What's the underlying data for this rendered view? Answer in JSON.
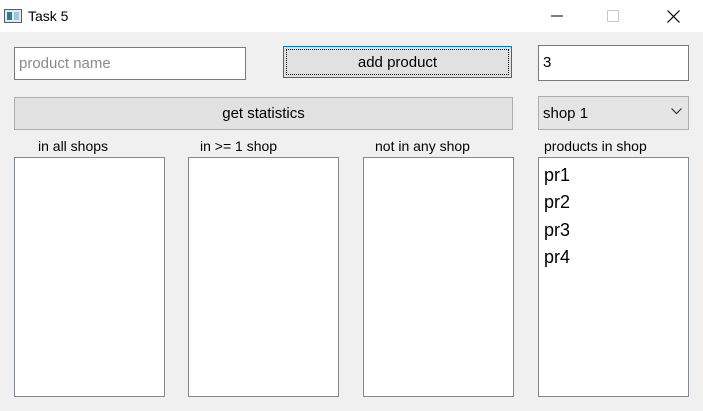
{
  "window": {
    "title": "Task 5",
    "icon": "app-window-icon",
    "controls": [
      "minimize-icon",
      "maximize-icon",
      "close-icon"
    ]
  },
  "form": {
    "product_name_placeholder": "product name",
    "product_name_value": "",
    "add_button_label": "add product",
    "quantity_value": "3",
    "stats_button_label": "get statistics",
    "shop_select_value": "shop 1"
  },
  "lists": {
    "all_shops_label": "in all shops",
    "at_least_one_label": "in >= 1 shop",
    "not_in_any_label": "not in any shop",
    "products_in_shop_label": "products in shop",
    "products_in_shop_items": [
      "pr1",
      "pr2",
      "pr3",
      "pr4"
    ]
  },
  "colors": {
    "window_bg": "#f0f0f0",
    "button_bg": "#e1e1e1",
    "focus_border": "#0078d7"
  }
}
